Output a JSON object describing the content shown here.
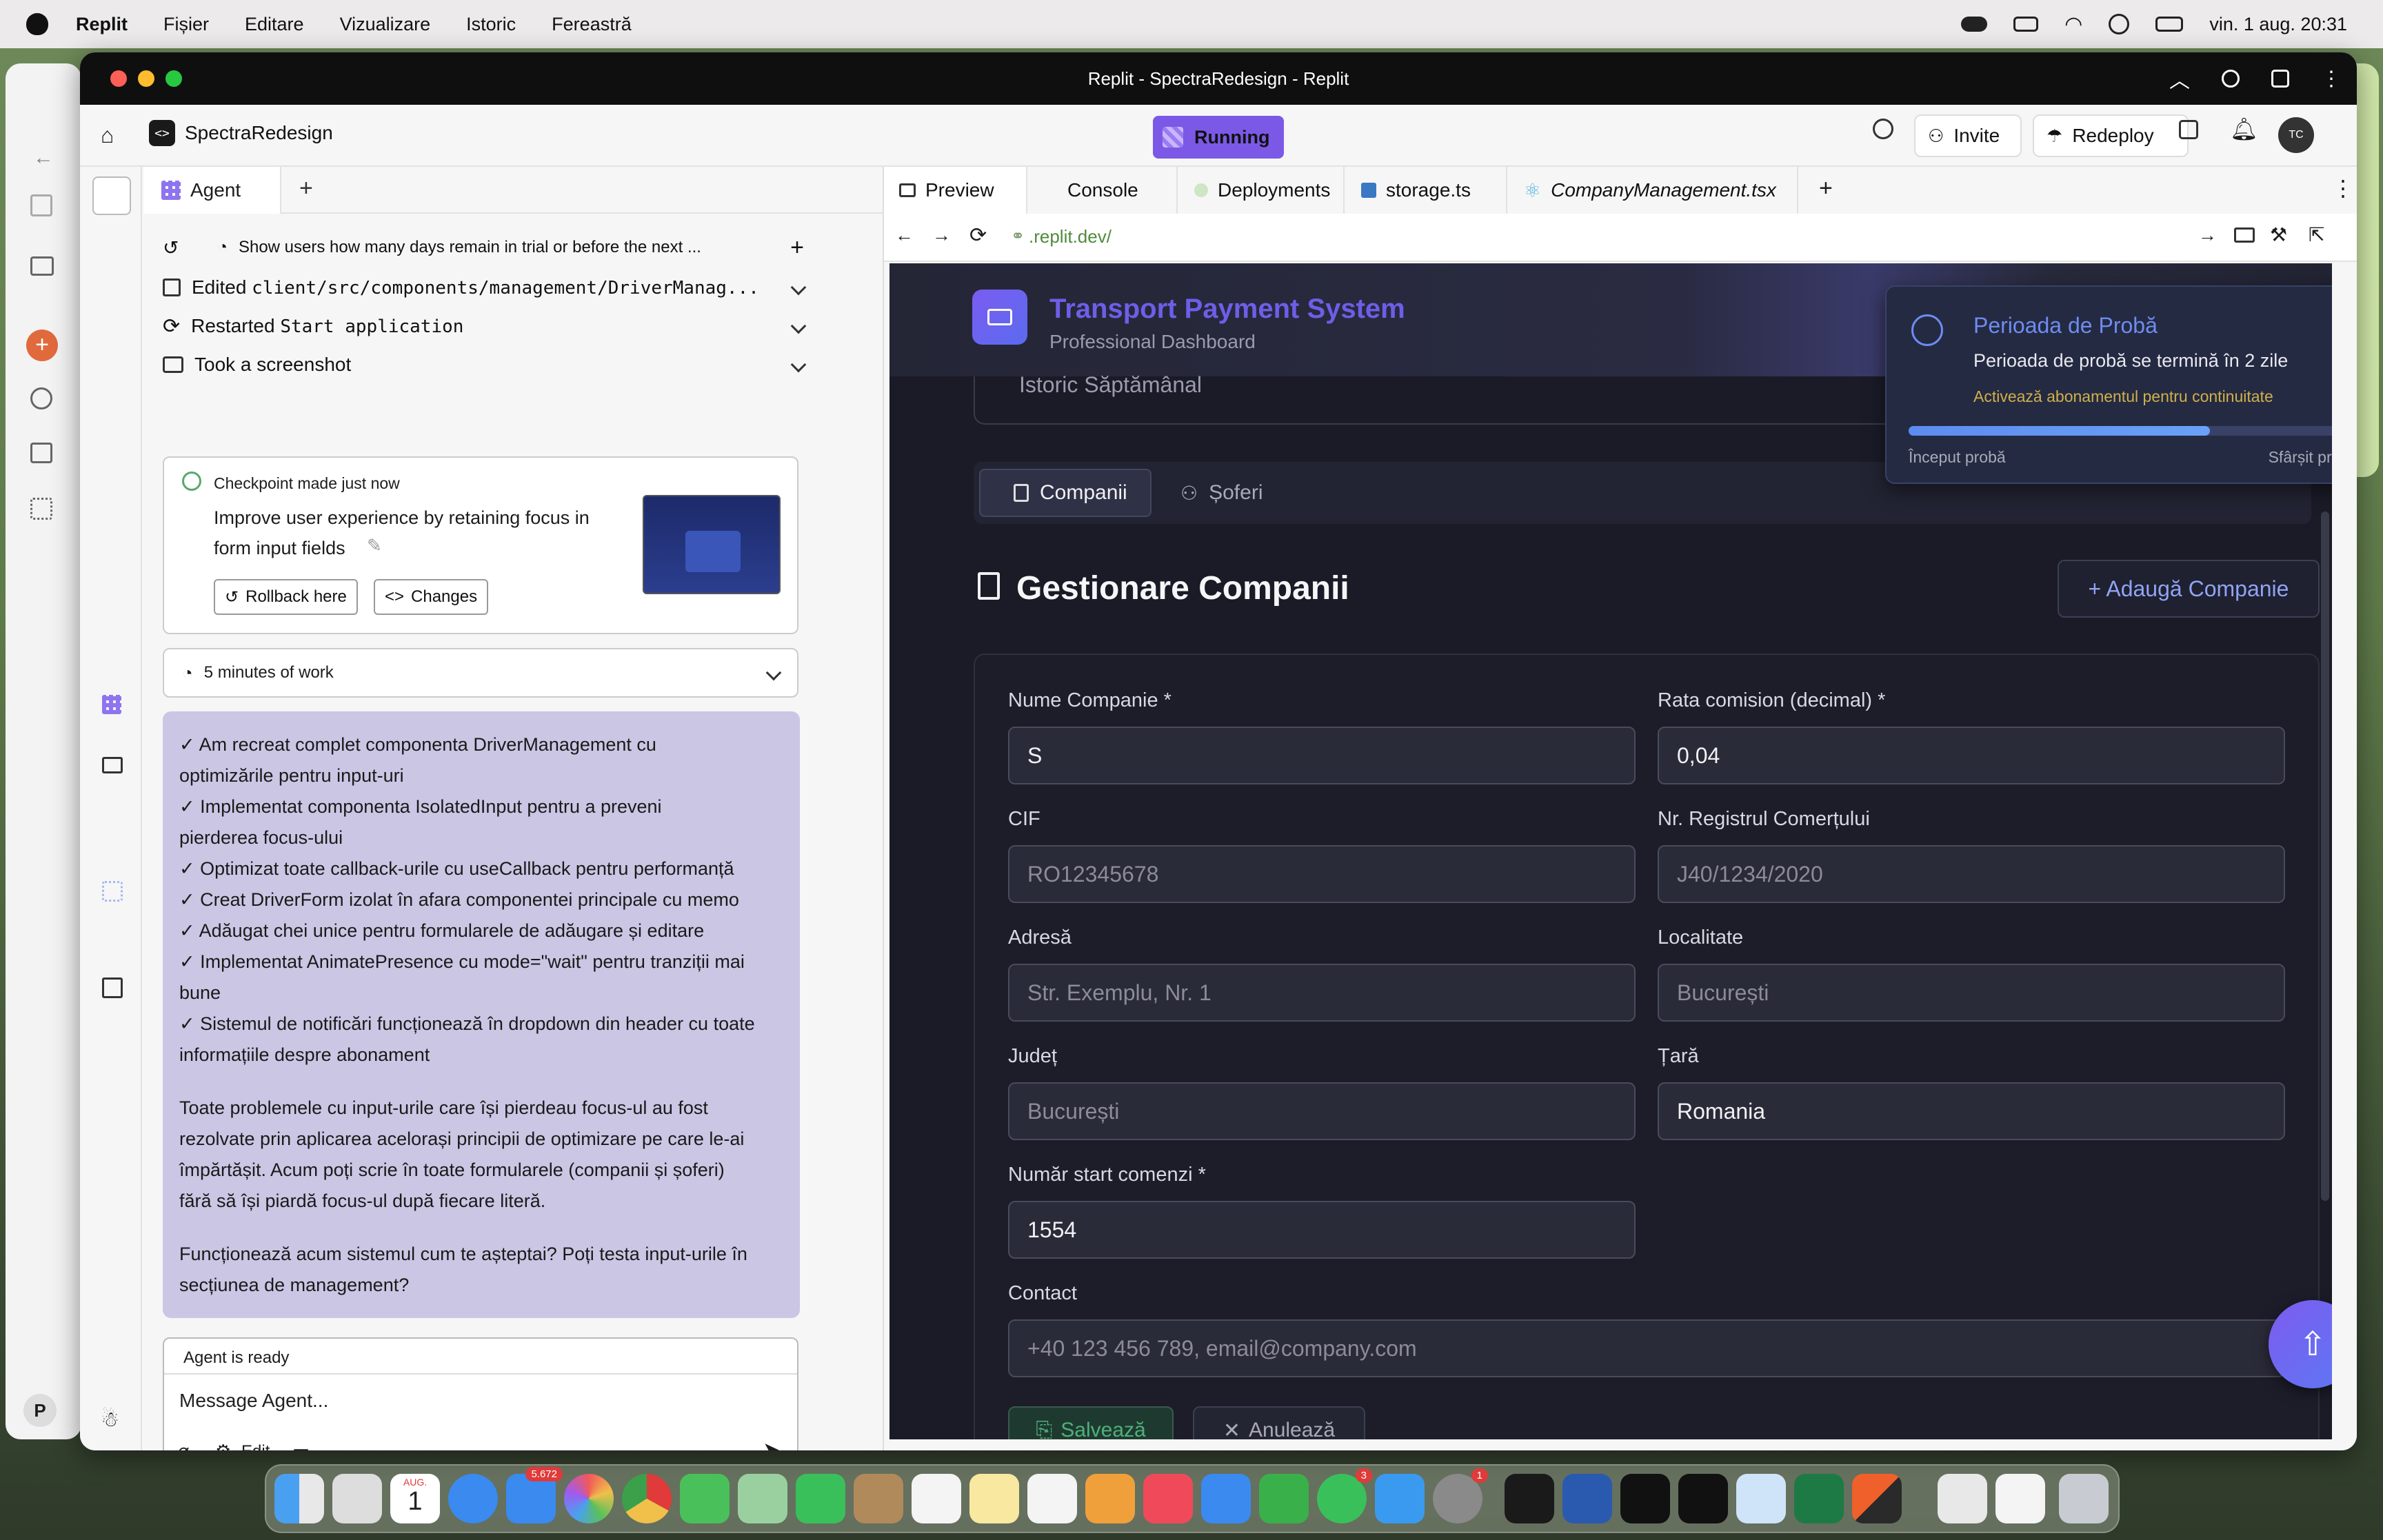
{
  "menubar": {
    "app_name": "Replit",
    "items": [
      "Fișier",
      "Editare",
      "Vizualizare",
      "Istoric",
      "Fereastră"
    ],
    "clock": "vin. 1 aug.  20:31"
  },
  "window": {
    "title": "Replit - SpectraRedesign - Replit"
  },
  "header": {
    "project_name": "SpectraRedesign",
    "run_label": "Running",
    "invite_label": "Invite",
    "redeploy_label": "Redeploy",
    "avatar_initials": "TC"
  },
  "sidebar": {
    "bottom_initial": "P",
    "help": "?"
  },
  "agent": {
    "tab_label": "Agent",
    "add_tab": "+",
    "history_title": "Show users how many days remain in trial or before the next ...",
    "actions": [
      {
        "prefix": "Edited ",
        "code": "client/src/components/management/DriverManag..."
      },
      {
        "prefix": "Restarted ",
        "code": "Start application"
      },
      {
        "prefix": "Took a screenshot",
        "code": ""
      }
    ],
    "checkpoint_title": "Checkpoint made just now",
    "checkpoint_desc_1": "Improve user experience by retaining focus in",
    "checkpoint_desc_2": "form input fields",
    "rollback_label": "Rollback here",
    "changes_label": "Changes",
    "work_label": "5 minutes of work",
    "message_lines": [
      "✓ Am recreat complet componenta DriverManagement cu",
      "optimizările pentru input-uri",
      "✓ Implementat componenta IsolatedInput pentru a preveni",
      "pierderea focus-ului",
      "✓ Optimizat toate callback-urile cu useCallback pentru performanță",
      "✓ Creat DriverForm izolat în afara componentei principale cu memo",
      "✓ Adăugat chei unice pentru formularele de adăugare și editare",
      "✓ Implementat AnimatePresence cu mode=\"wait\" pentru tranziții mai",
      "bune",
      "✓ Sistemul de notificări funcționează în dropdown din header cu toate",
      "informațiile despre abonament"
    ],
    "paragraph_lines": [
      "Toate problemele cu input-urile care își pierdeau focus-ul au fost",
      "rezolvate prin aplicarea acelorași principii de optimizare pe care le-ai",
      "împărtășit. Acum poți scrie în toate formularele (companii și șoferi)",
      "fără să își piardă focus-ul după fiecare literă."
    ],
    "question_lines": [
      "Funcționează acum sistemul cum te așteptai? Poți testa input-urile în",
      "secțiunea de management?"
    ],
    "status": "Agent is ready",
    "input_placeholder": "Message Agent...",
    "edit_label": "Edit"
  },
  "tabs": [
    {
      "label": "Preview"
    },
    {
      "label": "Console"
    },
    {
      "label": "Deployments"
    },
    {
      "label": "storage.ts"
    },
    {
      "label": "CompanyManagement.tsx"
    }
  ],
  "url": {
    "value": ".replit.dev/"
  },
  "app": {
    "title": "Transport Payment System",
    "subtitle": "Professional Dashboard",
    "hidden_row": "Istoric Săptămânal",
    "tab_companies": "Companii",
    "tab_drivers": "Șoferi",
    "section_title": "Gestionare Companii",
    "add_company": "+ Adaugă Companie",
    "fields": {
      "name_label": "Nume Companie *",
      "name_value": "S",
      "rate_label": "Rata comision (decimal) *",
      "rate_value": "0,04",
      "cif_label": "CIF",
      "cif_placeholder": "RO12345678",
      "reg_label": "Nr. Registrul Comerțului",
      "reg_placeholder": "J40/1234/2020",
      "address_label": "Adresă",
      "address_placeholder": "Str. Exemplu, Nr. 1",
      "city_label": "Localitate",
      "city_placeholder": "București",
      "county_label": "Județ",
      "county_placeholder": "București",
      "country_label": "Țară",
      "country_value": "Romania",
      "start_label": "Număr start comenzi *",
      "start_value": "1554",
      "contact_label": "Contact",
      "contact_placeholder": "+40 123 456 789, email@company.com"
    },
    "save_label": "Salvează",
    "cancel_label": "Anulează"
  },
  "trial_toast": {
    "title": "Perioada de Probă",
    "message": "Perioada de probă se termină în 2 zile",
    "cta": "Activează abonamentul pentru continuitate",
    "start_label": "Început probă",
    "end_label": "Sfârșit probă",
    "progress": 0.67
  },
  "dock": {
    "calendar_day": "1",
    "calendar_month": "AUG.",
    "mail_badge": "5.672",
    "whatsapp_badge": "3",
    "settings_badge": "1"
  },
  "colors": {
    "accent": "#7b59e6",
    "app_bg": "#1a1b27",
    "toast_title": "#6e8cf0",
    "toast_cta": "#d0b04a"
  }
}
